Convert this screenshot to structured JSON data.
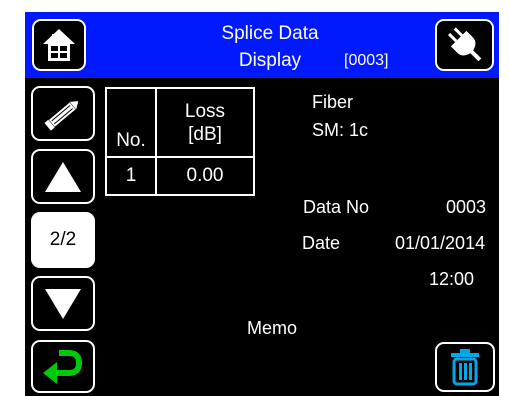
{
  "header": {
    "title_line1": "Splice Data",
    "title_line2": "Display",
    "record_code": "[0003]"
  },
  "sidebar": {
    "page_indicator": "2/2"
  },
  "loss_table": {
    "col_no_label": "No.",
    "col_loss_label": "Loss",
    "col_loss_unit": "[dB]",
    "rows": [
      {
        "no": "1",
        "loss": "0.00"
      }
    ]
  },
  "fiber": {
    "label": "Fiber",
    "type": "SM: 1c"
  },
  "details": {
    "data_no_label": "Data No",
    "data_no_value": "0003",
    "date_label": "Date",
    "date_value": "01/01/2014",
    "time_value": "12:00",
    "memo_label": "Memo"
  },
  "icons": {
    "home": "home-icon",
    "plug": "plug-icon",
    "edit": "pencil-icon",
    "up": "up-arrow-icon",
    "down": "down-arrow-icon",
    "back": "return-arrow-icon",
    "delete": "trash-icon"
  },
  "colors": {
    "titlebar": "#0019ff",
    "screen_bg": "#000000",
    "foreground": "#ffffff",
    "back_arrow": "#00c80a",
    "trash": "#00a8e8"
  }
}
